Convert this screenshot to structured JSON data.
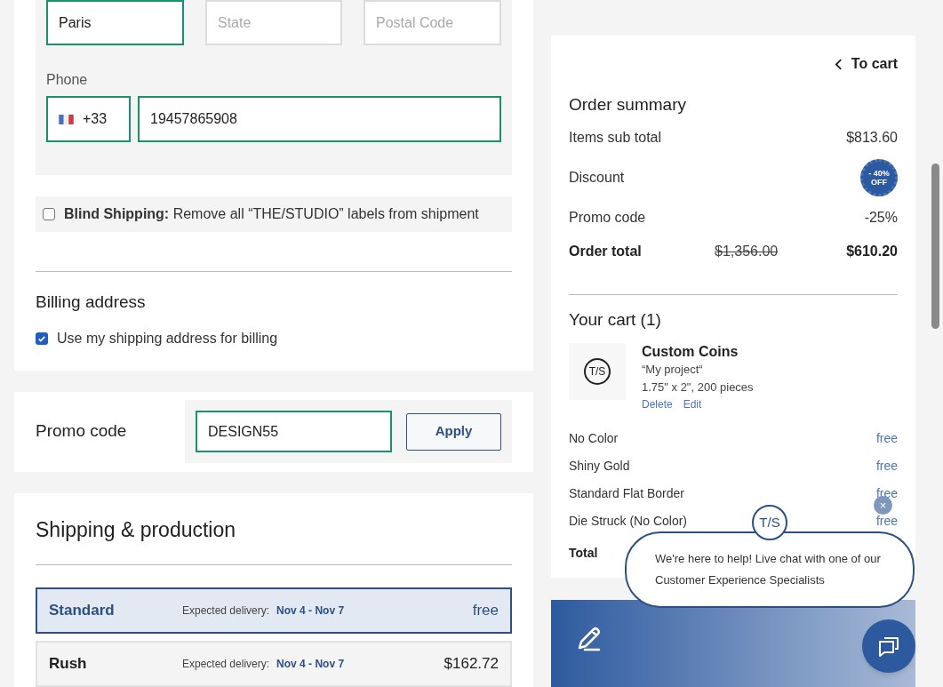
{
  "address": {
    "city": {
      "value": "Paris"
    },
    "state": {
      "placeholder": "State"
    },
    "postal": {
      "placeholder": "Postal Code"
    },
    "phone_label": "Phone",
    "phone": {
      "country_code": "+33",
      "value": "19457865908"
    }
  },
  "blind_shipping": {
    "checked": false,
    "text": "**Blind Shipping:** Remove all “THE/STUDIO” labels from shipment"
  },
  "billing": {
    "title": "Billing address",
    "checkbox": {
      "label": "Use my shipping address for billing",
      "checked": true
    }
  },
  "promo": {
    "label": "Promo code",
    "value": "DESIGN55",
    "button": "Apply"
  },
  "shipping": {
    "title": "Shipping & production",
    "options": [
      {
        "name": "Standard",
        "delivery_label": "Expected delivery:",
        "dates": "Nov 4 - Nov 7",
        "price": "free",
        "selected": true
      },
      {
        "name": "Rush",
        "delivery_label": "Expected delivery:",
        "dates": "Nov 4 - Nov 7",
        "price": "$162.72",
        "selected": false
      }
    ]
  },
  "summary": {
    "back_link": "To cart",
    "title": "Order summary",
    "rows": [
      {
        "kind": "text",
        "label": "Items sub total",
        "value": "$813.60"
      },
      {
        "kind": "badge",
        "label": "Discount",
        "badge_lines": [
          "- 40%",
          "OFF"
        ]
      },
      {
        "kind": "text",
        "label": "Promo code",
        "value": "-25%"
      }
    ],
    "total": {
      "label": "Order total",
      "old": "$1,356.00",
      "value": "$610.20"
    }
  },
  "cart": {
    "title": "Your cart (1)",
    "item": {
      "thumb": "T/S",
      "name": "Custom Coins",
      "project": "“My project“",
      "size": "1.75\" x 2\",  200 pieces",
      "actions": [
        "Delete",
        "Edit"
      ]
    },
    "options": [
      {
        "label": "No Color",
        "price": "free"
      },
      {
        "label": "Shiny Gold",
        "price": "free"
      },
      {
        "label": "Standard Flat Border",
        "price": "free"
      },
      {
        "label": "Die Struck (No Color)",
        "price": "free"
      }
    ],
    "total_label": "Total"
  },
  "chat": {
    "logo": "T/S",
    "close": "×",
    "message": "We're here to help! Live chat with one of our Customer Experience Specialists"
  }
}
